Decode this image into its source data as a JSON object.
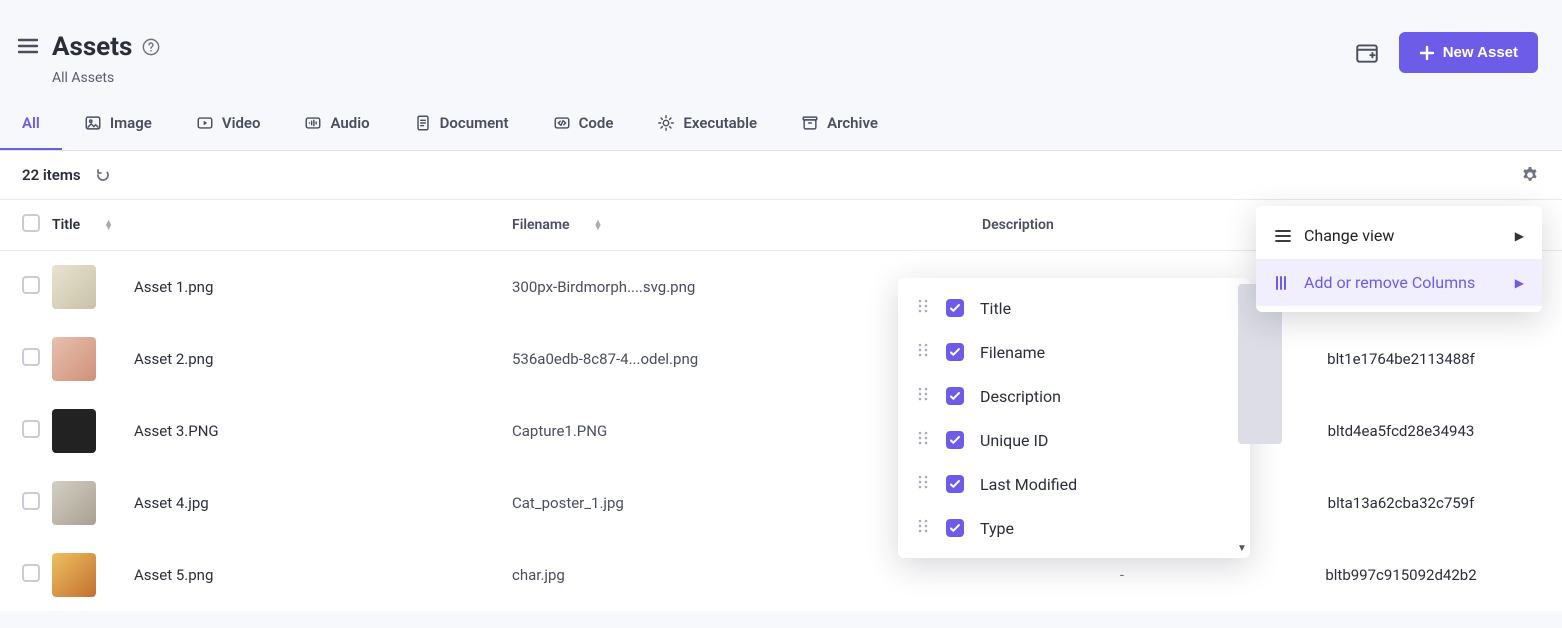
{
  "header": {
    "title": "Assets",
    "subtitle": "All Assets",
    "new_asset_label": "New Asset"
  },
  "tabs": [
    {
      "label": "All",
      "icon": "all"
    },
    {
      "label": "Image",
      "icon": "image"
    },
    {
      "label": "Video",
      "icon": "video"
    },
    {
      "label": "Audio",
      "icon": "audio"
    },
    {
      "label": "Document",
      "icon": "document"
    },
    {
      "label": "Code",
      "icon": "code"
    },
    {
      "label": "Executable",
      "icon": "executable"
    },
    {
      "label": "Archive",
      "icon": "archive"
    }
  ],
  "active_tab": 0,
  "item_count_label": "22 items",
  "columns": {
    "title": "Title",
    "filename": "Filename",
    "description": "Description",
    "unique_id": "Unique ID"
  },
  "rows": [
    {
      "title": "Asset 1.png",
      "filename": "300px-Birdmorph....svg.png",
      "description": "",
      "uid": ""
    },
    {
      "title": "Asset 2.png",
      "filename": "536a0edb-8c87-4...odel.png",
      "description": "",
      "uid": "blt1e1764be2113488f"
    },
    {
      "title": "Asset 3.PNG",
      "filename": "Capture1.PNG",
      "description": "",
      "uid": "bltd4ea5fcd28e34943"
    },
    {
      "title": "Asset 4.jpg",
      "filename": "Cat_poster_1.jpg",
      "description": "",
      "uid": "blta13a62cba32c759f"
    },
    {
      "title": "Asset 5.png",
      "filename": "char.jpg",
      "description": "-",
      "uid": "bltb997c915092d42b2"
    }
  ],
  "settings_menu": {
    "change_view": "Change view",
    "add_remove_columns": "Add or remove Columns"
  },
  "column_options": [
    {
      "label": "Title",
      "checked": true
    },
    {
      "label": "Filename",
      "checked": true
    },
    {
      "label": "Description",
      "checked": true
    },
    {
      "label": "Unique ID",
      "checked": true
    },
    {
      "label": "Last Modified",
      "checked": true
    },
    {
      "label": "Type",
      "checked": true
    }
  ]
}
